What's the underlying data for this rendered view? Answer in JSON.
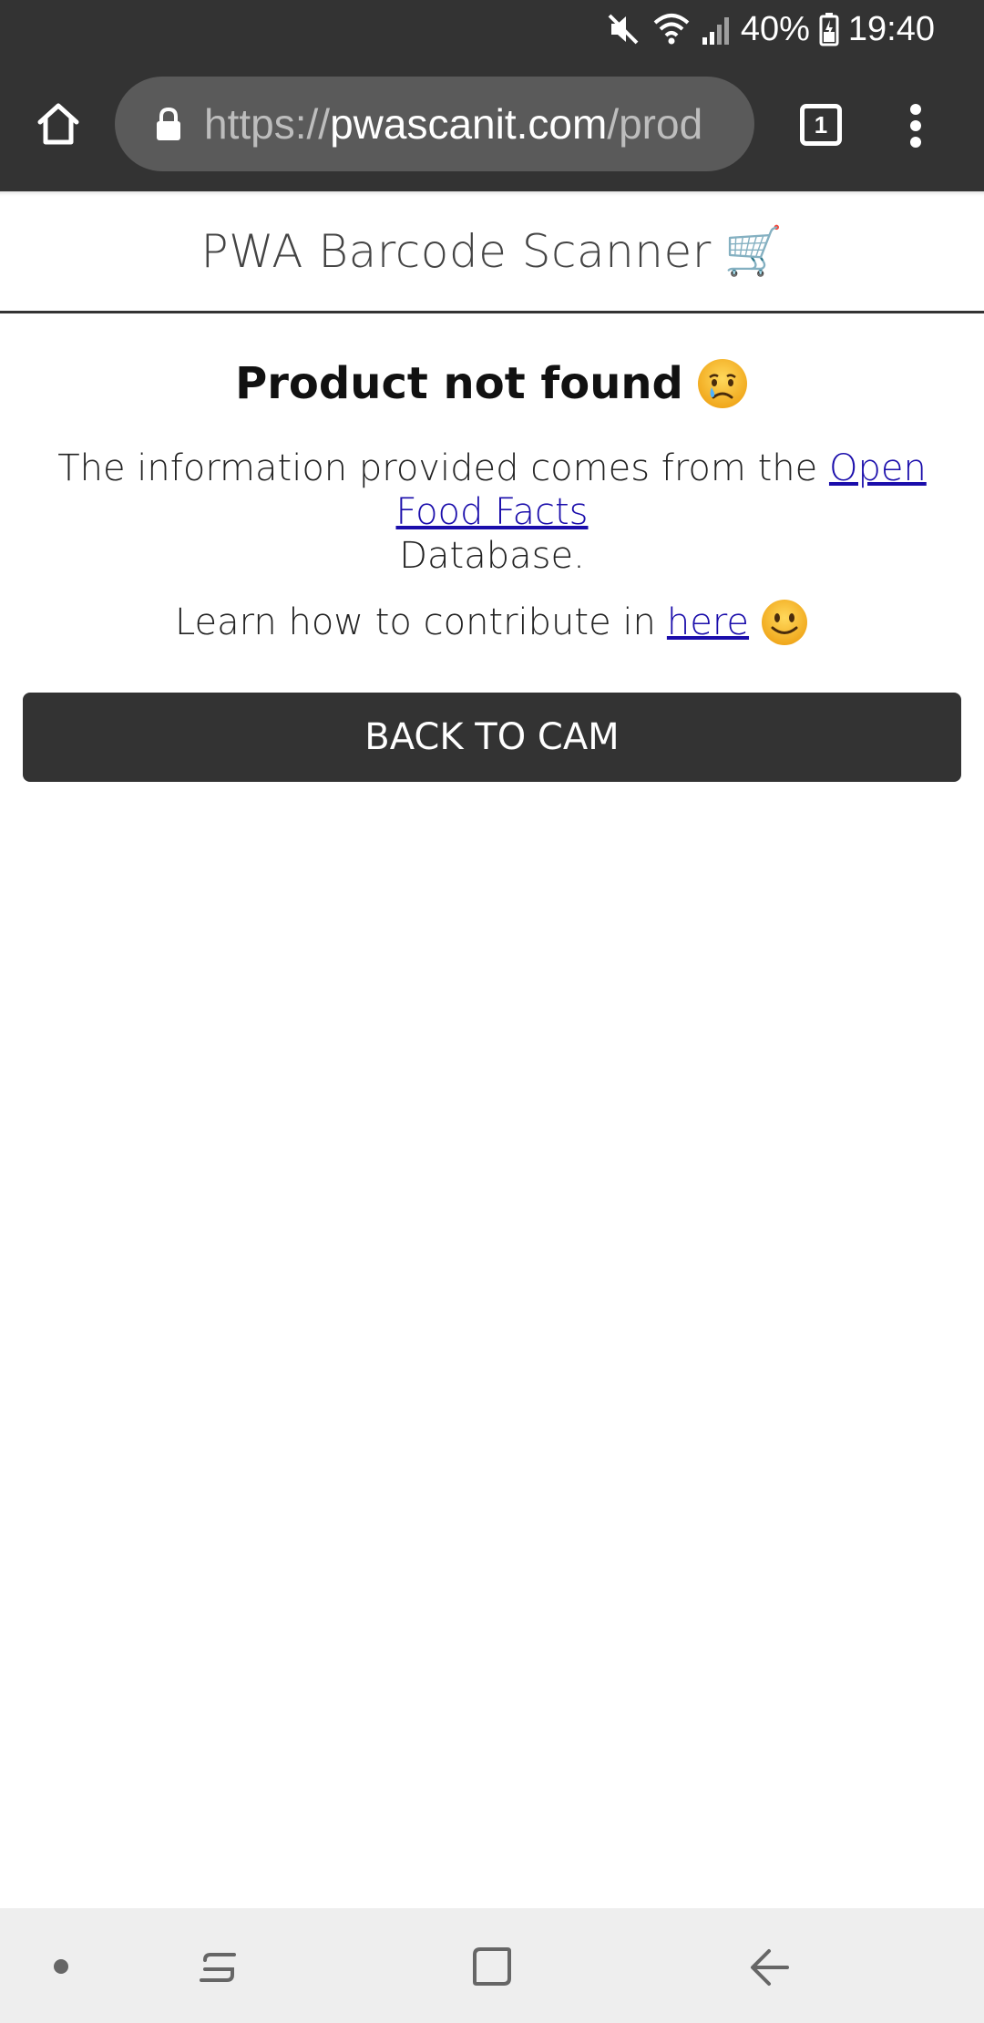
{
  "status_bar": {
    "battery": "40%",
    "time": "19:40",
    "icons": [
      "mute-icon",
      "wifi-icon",
      "signal-icon",
      "battery-icon"
    ]
  },
  "browser": {
    "url_prefix": "https://",
    "url_domain": "pwascanit.com",
    "url_path": "/prod",
    "tab_count": "1",
    "icons": [
      "home-icon",
      "lock-icon",
      "tabs-icon",
      "menu-icon"
    ]
  },
  "app": {
    "title": "PWA Barcode Scanner",
    "title_emoji": "🛒"
  },
  "result": {
    "title": "Product not found",
    "title_emoji": "crying-face-icon",
    "info_prefix": "The information provided comes from the",
    "info_link": "Open Food Facts",
    "info_suffix": "Database.",
    "learn_prefix": "Learn how to contribute in",
    "learn_link": "here",
    "learn_emoji": "smile-icon",
    "back_button": "BACK TO CAM"
  },
  "nav_bar": {
    "icons": [
      "dot-icon",
      "recents-icon",
      "home-square-icon",
      "back-arrow-icon"
    ]
  },
  "colors": {
    "chrome": "#333333",
    "url_bar": "#5a5a5a",
    "link": "#1a0dab",
    "nav_bg": "#eeeeee"
  }
}
